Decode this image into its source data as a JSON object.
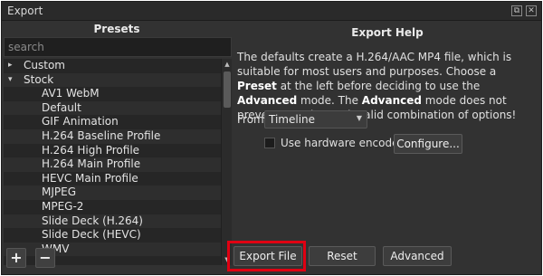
{
  "window": {
    "title": "Export"
  },
  "presets": {
    "header": "Presets",
    "search_placeholder": "search",
    "items": [
      {
        "label": "Custom",
        "arrow": "▸"
      },
      {
        "label": "Stock",
        "arrow": "▾"
      },
      {
        "label": "AV1 WebM"
      },
      {
        "label": "Default"
      },
      {
        "label": "GIF Animation"
      },
      {
        "label": "H.264 Baseline Profile"
      },
      {
        "label": "H.264 High Profile"
      },
      {
        "label": "H.264 Main Profile"
      },
      {
        "label": "HEVC Main Profile"
      },
      {
        "label": "MJPEG"
      },
      {
        "label": "MPEG-2"
      },
      {
        "label": "Slide Deck (H.264)"
      },
      {
        "label": "Slide Deck (HEVC)"
      },
      {
        "label": "WMV"
      }
    ],
    "add_symbol": "+",
    "remove_symbol": "−"
  },
  "help": {
    "header": "Export Help",
    "text_1": "The defaults create a H.264/AAC MP4 file, which is suitable for most users and purposes. Choose a ",
    "bold_1": "Preset",
    "text_2": " at the left before deciding to use the ",
    "bold_2": "Advanced",
    "text_3": " mode. The ",
    "bold_3": "Advanced",
    "text_4": " mode does not prevent creating an invalid combination of options!"
  },
  "from": {
    "label": "From",
    "value": "Timeline"
  },
  "hardware": {
    "label": "Use hardware encoder",
    "configure_label": "Configure..."
  },
  "buttons": {
    "export_file": "Export File",
    "reset": "Reset",
    "advanced": "Advanced"
  },
  "colors": {
    "highlight": "#e00012",
    "background": "#323232"
  }
}
